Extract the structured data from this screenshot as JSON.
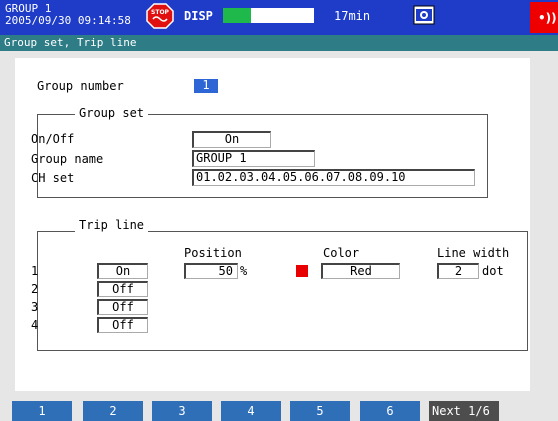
{
  "status_bar": {
    "group_title": "GROUP 1",
    "datetime": "2005/09/30 09:14:58",
    "disp_label": "DISP",
    "memory_time": "17min",
    "memory_fill": 0.31,
    "stop_icon": "stop-icon",
    "camera_icon": "camera-icon",
    "alarm_icon": "alarm-signal-icon"
  },
  "screen": {
    "title": "Group set, Trip line"
  },
  "group_number": {
    "label": "Group number",
    "value": "1"
  },
  "group_set": {
    "title": "Group set",
    "on_off_label": "On/Off",
    "on_off_value": "On",
    "group_name_label": "Group name",
    "group_name_value": "GROUP 1",
    "ch_set_label": "CH set",
    "ch_set_value": "01.02.03.04.05.06.07.08.09.10"
  },
  "trip_line": {
    "title": "Trip line",
    "position_header": "Position",
    "color_header": "Color",
    "line_width_header": "Line width",
    "position_unit": "%",
    "width_unit": "dot",
    "lines": [
      {
        "index": "1",
        "state": "On"
      },
      {
        "index": "2",
        "state": "Off"
      },
      {
        "index": "3",
        "state": "Off"
      },
      {
        "index": "4",
        "state": "Off"
      }
    ],
    "position_value": "50",
    "color_value": "Red",
    "color_swatch": "#e80000",
    "line_width_value": "2"
  },
  "softkeys": [
    "1",
    "2",
    "3",
    "4",
    "5",
    "6",
    "Next 1/6"
  ],
  "colors": {
    "top_bar": "#1e3cc8",
    "title_strip": "#2d7c86",
    "softkey": "#2f6fb8",
    "softkey_next": "#4d4d4d",
    "selected_field": "#2f66d6"
  }
}
